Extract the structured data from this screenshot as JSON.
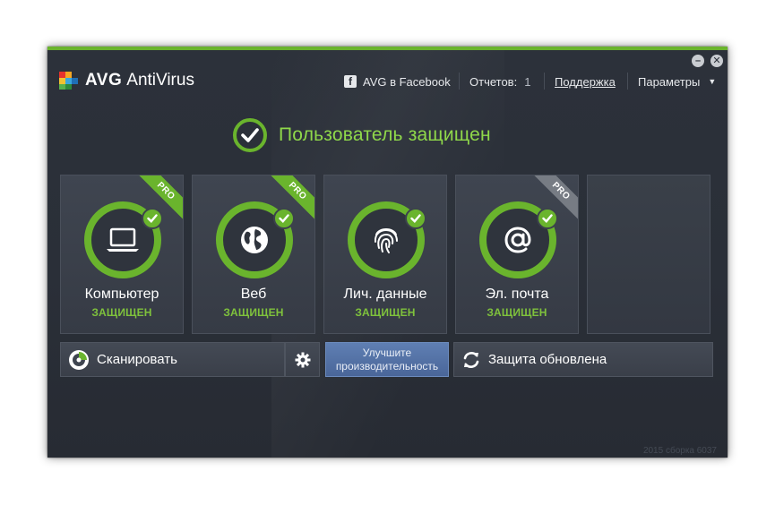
{
  "app": {
    "brand": "AVG",
    "product": "AntiVirus"
  },
  "window_controls": {
    "minimize": "–",
    "close": "✕"
  },
  "topnav": {
    "facebook": "AVG в Facebook",
    "facebook_icon": "f",
    "reports_label": "Отчетов:",
    "reports_count": "1",
    "support": "Поддержка",
    "settings": "Параметры",
    "settings_arrow": "▼"
  },
  "status": {
    "text": "Пользователь защищен"
  },
  "tiles": [
    {
      "title": "Компьютер",
      "status": "ЗАЩИЩЕН",
      "pro": "PRO",
      "icon": "laptop-icon"
    },
    {
      "title": "Веб",
      "status": "ЗАЩИЩЕН",
      "pro": "PRO",
      "icon": "globe-icon"
    },
    {
      "title": "Лич. данные",
      "status": "ЗАЩИЩЕН",
      "icon": "fingerprint-icon"
    },
    {
      "title": "Эл. почта",
      "status": "ЗАЩИЩЕН",
      "pro": "PRO",
      "icon": "at-sign-icon"
    }
  ],
  "actions": {
    "scan": "Сканировать",
    "improve_line1": "Улучшите",
    "improve_line2": "производительность",
    "update": "Защита обновлена"
  },
  "footer": {
    "build": "2015  сборка 6037"
  },
  "colors": {
    "accent": "#6ab42d",
    "status_text": "#8fd84a",
    "background": "#2c313a",
    "perf_button": "#5673a6"
  }
}
